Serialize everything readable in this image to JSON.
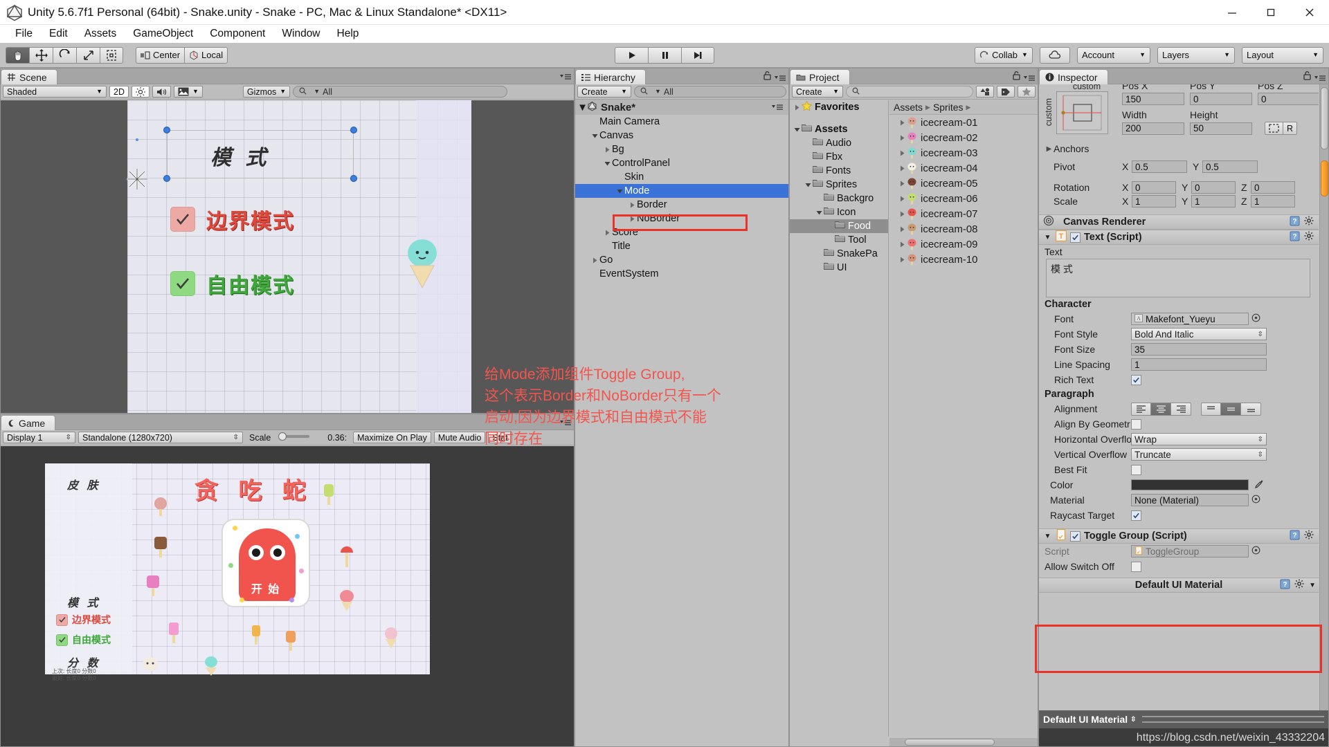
{
  "window": {
    "title": "Unity 5.6.7f1 Personal (64bit) - Snake.unity - Snake - PC, Mac & Linux Standalone* <DX11>",
    "logo_icon": "unity-logo-icon",
    "minimize_icon": "minimize-icon",
    "maximize_icon": "maximize-icon",
    "close_icon": "close-icon"
  },
  "menubar": {
    "items": [
      "File",
      "Edit",
      "Assets",
      "GameObject",
      "Component",
      "Window",
      "Help"
    ]
  },
  "toolbar": {
    "transform_tools": [
      {
        "name": "hand-tool",
        "icon": "hand-icon",
        "active": true
      },
      {
        "name": "move-tool",
        "icon": "move-arrows-icon",
        "active": false
      },
      {
        "name": "rotate-tool",
        "icon": "rotate-icon",
        "active": false
      },
      {
        "name": "scale-tool",
        "icon": "scale-icon",
        "active": false
      },
      {
        "name": "rect-tool",
        "icon": "rect-transform-icon",
        "active": false
      }
    ],
    "pivot_mode": "Center",
    "pivot_rotation": "Local",
    "play": "play-icon",
    "pause": "pause-icon",
    "step": "step-icon",
    "collab": "Collab",
    "cloud_icon": "cloud-icon",
    "account": "Account",
    "layers": "Layers",
    "layout": "Layout"
  },
  "scene": {
    "tab": "Scene",
    "tab_icon": "scene-grid-icon",
    "shading": "Shaded",
    "mode_2d": "2D",
    "lighting_icon": "lighting-icon",
    "audio_icon": "audio-icon",
    "fx_icon": "image-effects-icon",
    "gizmos": "Gizmos",
    "search_placeholder": "All",
    "search_value": "",
    "content": {
      "title": "模 式",
      "toggles": [
        {
          "label": "边界模式",
          "checked": true,
          "color": "#e0483c",
          "box": "red"
        },
        {
          "label": "自由模式",
          "checked": true,
          "color": "#3fa83a",
          "box": "green"
        }
      ]
    }
  },
  "game": {
    "tab": "Game",
    "tab_icon": "game-controller-icon",
    "display": "Display 1",
    "resolution": "Standalone (1280x720)",
    "scale_label": "Scale",
    "scale_value": "0.36:",
    "maximize_on_play": "Maximize On Play",
    "mute_audio": "Mute Audio",
    "stats": "Stat",
    "content": {
      "skin_title": "皮 肤",
      "mode_title": "模 式",
      "score_title": "分 数",
      "toggles": [
        {
          "label": "边界模式",
          "checked": true,
          "box": "red"
        },
        {
          "label": "自由模式",
          "checked": true,
          "box": "green"
        }
      ],
      "big_title": "贪 吃 蛇",
      "start_button": "开 始",
      "score_lines": [
        "上次: 长度0  分数0",
        "最好: 长度0  分数0"
      ]
    }
  },
  "hierarchy": {
    "tab": "Hierarchy",
    "tab_icon": "hierarchy-icon",
    "create_label": "Create",
    "search_placeholder": "All",
    "search_value": "",
    "scene_name": "Snake*",
    "items": [
      {
        "label": "Main Camera",
        "depth": 1,
        "arrow": "none",
        "selected": false
      },
      {
        "label": "Canvas",
        "depth": 1,
        "arrow": "down",
        "selected": false
      },
      {
        "label": "Bg",
        "depth": 2,
        "arrow": "right",
        "selected": false
      },
      {
        "label": "ControlPanel",
        "depth": 2,
        "arrow": "down",
        "selected": false
      },
      {
        "label": "Skin",
        "depth": 3,
        "arrow": "none",
        "selected": false
      },
      {
        "label": "Mode",
        "depth": 3,
        "arrow": "down",
        "selected": true
      },
      {
        "label": "Border",
        "depth": 4,
        "arrow": "right",
        "selected": false
      },
      {
        "label": "NoBorder",
        "depth": 4,
        "arrow": "right",
        "selected": false
      },
      {
        "label": "Score",
        "depth": 2,
        "arrow": "right",
        "selected": false
      },
      {
        "label": "Title",
        "depth": 2,
        "arrow": "none",
        "selected": false
      },
      {
        "label": "Go",
        "depth": 1,
        "arrow": "right",
        "selected": false
      },
      {
        "label": "EventSystem",
        "depth": 1,
        "arrow": "none",
        "selected": false
      }
    ]
  },
  "project": {
    "tab": "Project",
    "tab_icon": "project-folder-icon",
    "create_label": "Create",
    "search_placeholder": "",
    "search_value": "",
    "filter_icons": [
      "type-filter-icon",
      "label-filter-icon",
      "favorite-star-icon"
    ],
    "tree": [
      {
        "label": "Favorites",
        "depth": 0,
        "arrow": "right",
        "icon": "star-icon",
        "bold": true,
        "selected": false
      },
      {
        "label": "Assets",
        "depth": 0,
        "arrow": "down",
        "icon": "folder-icon",
        "bold": true,
        "selected": false
      },
      {
        "label": "Audio",
        "depth": 1,
        "arrow": "none",
        "icon": "folder-icon",
        "bold": false,
        "selected": false
      },
      {
        "label": "Fbx",
        "depth": 1,
        "arrow": "none",
        "icon": "folder-icon",
        "bold": false,
        "selected": false
      },
      {
        "label": "Fonts",
        "depth": 1,
        "arrow": "none",
        "icon": "folder-icon",
        "bold": false,
        "selected": false
      },
      {
        "label": "Sprites",
        "depth": 1,
        "arrow": "down",
        "icon": "folder-icon",
        "bold": false,
        "selected": false
      },
      {
        "label": "Backgro",
        "depth": 2,
        "arrow": "none",
        "icon": "folder-icon",
        "bold": false,
        "selected": false
      },
      {
        "label": "Icon",
        "depth": 2,
        "arrow": "down",
        "icon": "folder-icon",
        "bold": false,
        "selected": false
      },
      {
        "label": "Food",
        "depth": 3,
        "arrow": "none",
        "icon": "folder-icon",
        "bold": false,
        "selected": true
      },
      {
        "label": "Tool",
        "depth": 3,
        "arrow": "none",
        "icon": "folder-icon",
        "bold": false,
        "selected": false
      },
      {
        "label": "SnakePa",
        "depth": 2,
        "arrow": "none",
        "icon": "folder-icon",
        "bold": false,
        "selected": false
      },
      {
        "label": "UI",
        "depth": 2,
        "arrow": "none",
        "icon": "folder-icon",
        "bold": false,
        "selected": false
      }
    ],
    "breadcrumb": [
      "Assets",
      "Sprites"
    ],
    "assets": [
      {
        "label": "icecream-01",
        "color": "#d9a08f"
      },
      {
        "label": "icecream-02",
        "color": "#e87fc0"
      },
      {
        "label": "icecream-03",
        "color": "#7fd9cf"
      },
      {
        "label": "icecream-04",
        "color": "#f4f0e6"
      },
      {
        "label": "icecream-05",
        "color": "#7a4632"
      },
      {
        "label": "icecream-06",
        "color": "#c3dd6f"
      },
      {
        "label": "icecream-07",
        "color": "#e8544c"
      },
      {
        "label": "icecream-08",
        "color": "#c89a72"
      },
      {
        "label": "icecream-09",
        "color": "#ef6f72"
      },
      {
        "label": "icecream-10",
        "color": "#d7917a"
      }
    ]
  },
  "inspector": {
    "tab": "Inspector",
    "tab_icon": "info-icon",
    "anchor_preset_label": "custom",
    "anchor_side_label": "custom",
    "rect": {
      "pos_x_label": "Pos X",
      "pos_x": "150",
      "pos_y_label": "Pos Y",
      "pos_y": "0",
      "pos_z_label": "Pos Z",
      "pos_z": "0",
      "width_label": "Width",
      "width": "200",
      "height_label": "Height",
      "height": "50",
      "blueprint_icon": "blueprint-mode-icon",
      "raw_label": "R"
    },
    "anchors_label": "Anchors",
    "pivot_label": "Pivot",
    "pivot_x": "0.5",
    "pivot_y": "0.5",
    "rotation_label": "Rotation",
    "rotation": {
      "x": "0",
      "y": "0",
      "z": "0"
    },
    "scale_label": "Scale",
    "scale": {
      "x": "1",
      "y": "1",
      "z": "1"
    },
    "canvas_renderer": {
      "title": "Canvas Renderer",
      "icon": "canvas-renderer-icon",
      "help_icon": "help-icon",
      "settings_icon": "gear-icon"
    },
    "text_script": {
      "title": "Text (Script)",
      "icon": "text-component-icon",
      "enabled": true,
      "text_label": "Text",
      "text_value": "模 式",
      "character_label": "Character",
      "font_label": "Font",
      "font_value": "Makefont_Yueyu",
      "font_style_label": "Font Style",
      "font_style_value": "Bold And Italic",
      "font_size_label": "Font Size",
      "font_size_value": "35",
      "line_spacing_label": "Line Spacing",
      "line_spacing_value": "1",
      "rich_text_label": "Rich Text",
      "rich_text_checked": true,
      "paragraph_label": "Paragraph",
      "alignment_label": "Alignment",
      "align_h_selected": 1,
      "align_v_selected": 1,
      "align_by_geometry_label": "Align By Geometr",
      "align_by_geometry_checked": false,
      "horizontal_overflow_label": "Horizontal Overflo",
      "horizontal_overflow_value": "Wrap",
      "vertical_overflow_label": "Vertical Overflow",
      "vertical_overflow_value": "Truncate",
      "best_fit_label": "Best Fit",
      "best_fit_checked": false,
      "color_label": "Color",
      "color_value": "#323232",
      "eyedropper_icon": "eyedropper-icon",
      "material_label": "Material",
      "material_value": "None (Material)",
      "raycast_target_label": "Raycast Target",
      "raycast_target_checked": true
    },
    "toggle_group": {
      "title": "Toggle Group (Script)",
      "icon": "script-component-icon",
      "enabled": true,
      "script_label": "Script",
      "script_value": "ToggleGroup",
      "allow_switch_off_label": "Allow Switch Off",
      "allow_switch_off_checked": false
    },
    "material_footer": {
      "title": "Default UI Material",
      "selector_value": "Default UI Material"
    }
  },
  "annotation": {
    "lines": [
      "给Mode添加组件Toggle Group,",
      "这个表示Border和NoBorder只有一个",
      "启动,因为边界模式和自由模式不能",
      "同时存在"
    ],
    "color": "#f2554d"
  },
  "watermark": "https://blog.csdn.net/weixin_43332204"
}
